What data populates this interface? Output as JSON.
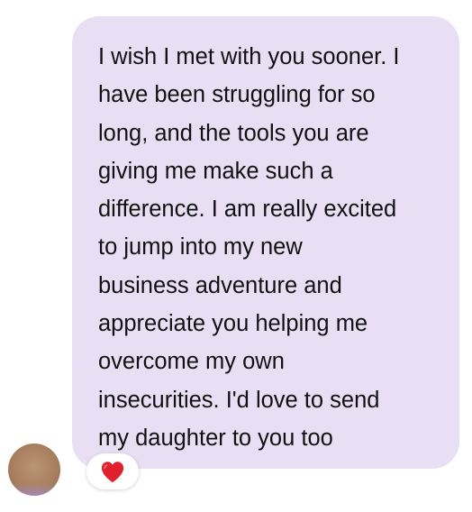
{
  "message": {
    "text": "I wish I met with you sooner. I\nhave been struggling for so\nlong, and the tools you are\ngiving me make such a\ndifference. I am really excited\nto jump into my new\nbusiness adventure and\nappreciate you helping me\novercome my own\ninsecurities. I'd love to send\nmy daughter to you too",
    "bubble_color": "#e8dff5"
  },
  "reaction": {
    "icon": "red-heart-icon",
    "color": "#e0202c"
  }
}
